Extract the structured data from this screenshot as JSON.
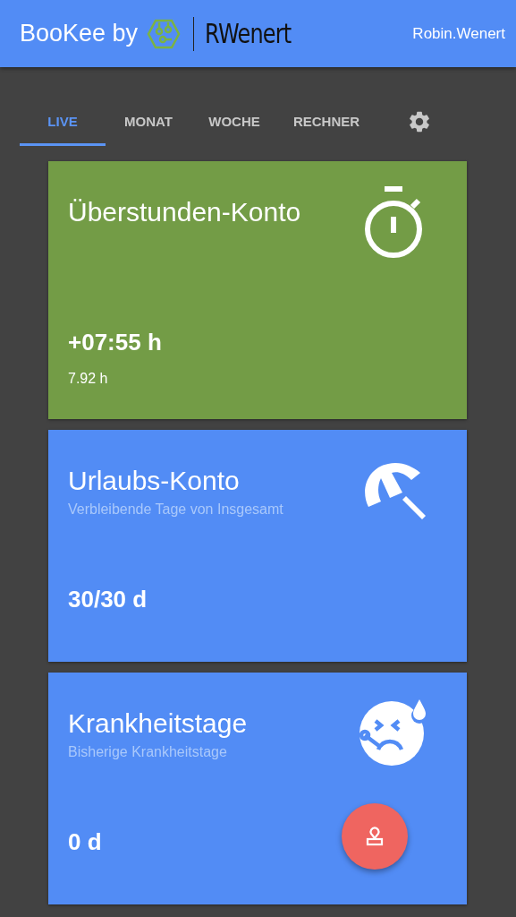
{
  "header": {
    "brand": "BooKee by",
    "company": "RWenert",
    "user": "Robin.Wenert"
  },
  "tabs": [
    {
      "label": "LIVE",
      "selected": true
    },
    {
      "label": "MONAT",
      "selected": false
    },
    {
      "label": "WOCHE",
      "selected": false
    },
    {
      "label": "RECHNER",
      "selected": false
    }
  ],
  "cards": [
    {
      "kind": "overtime",
      "color": "#739c46",
      "title": "Überstunden-Konto",
      "value": "+07:55 h",
      "note": "7.92 h"
    },
    {
      "kind": "vacation",
      "color": "#528cf5",
      "title": "Urlaubs-Konto",
      "subtitle": "Verbleibende Tage von Insgesamt",
      "value": "30/30 d"
    },
    {
      "kind": "sick",
      "color": "#528cf5",
      "title": "Krankheitstage",
      "subtitle": "Bisherige Krankheitstage",
      "value": "0 d"
    }
  ]
}
